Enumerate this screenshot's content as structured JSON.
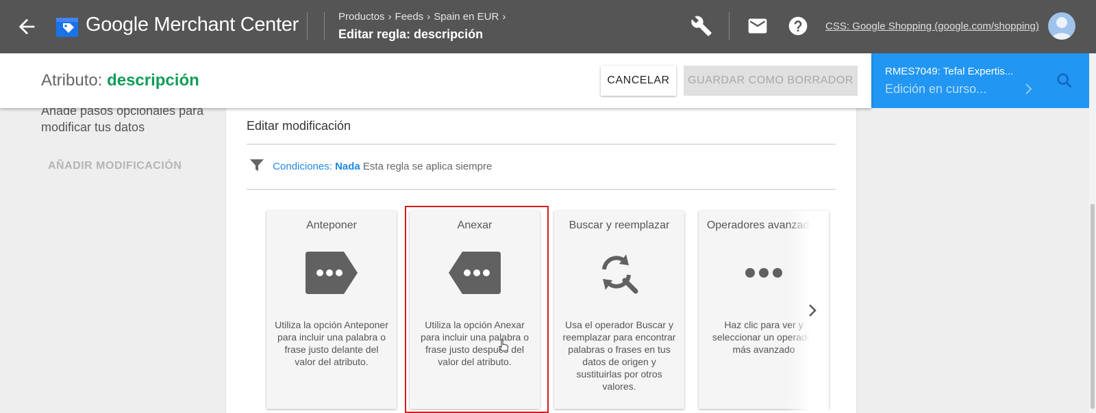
{
  "topbar": {
    "app_title": "Google Merchant Center",
    "breadcrumbs": [
      "Productos",
      "Feeds",
      "Spain en EUR"
    ],
    "page_heading": "Editar regla: descripción",
    "account_link": "CSS: Google Shopping (google.com/shopping)",
    "icons": [
      "back-arrow-icon",
      "merchant-center-logo-icon",
      "wrench-icon",
      "mail-icon",
      "help-icon",
      "avatar"
    ]
  },
  "header": {
    "attr_label": "Atributo:",
    "attr_value": "descripción",
    "cancel_label": "CANCELAR",
    "draft_label": "GUARDAR COMO BORRADOR"
  },
  "task": {
    "title": "RMES7049: Tefal Expertis...",
    "status": "Edición en curso..."
  },
  "left": {
    "description": "Añade pasos opcionales para modificar tus datos",
    "add_label": "AÑADIR MODIFICACIÓN"
  },
  "edit": {
    "section_title": "Editar modificación",
    "conditions_label": "Condiciones:",
    "conditions_value": "Nada",
    "conditions_text": "Esta regla se aplica siempre"
  },
  "operations": [
    {
      "title": "Anteponer",
      "icon": "prepend-tag-icon",
      "desc": "Utiliza la opción Anteponer para incluir una palabra o frase justo delante del valor del atributo."
    },
    {
      "title": "Anexar",
      "icon": "append-tag-icon",
      "desc": "Utiliza la opción Anexar para incluir una palabra o frase justo después del valor del atributo."
    },
    {
      "title": "Buscar y reemplazar",
      "icon": "search-replace-icon",
      "desc": "Usa el operador Buscar y reemplazar para encontrar palabras o frases en tus datos de origen y sustituirlas por otros valores."
    },
    {
      "title": "Operadores avanzados",
      "icon": "more-dots-icon",
      "desc": "Haz clic para ver y seleccionar un operador más avanzado"
    }
  ],
  "colors": {
    "topbar": "#555555",
    "accent_green": "#0f9d58",
    "link_blue": "#1e88e5",
    "task_blue": "#2196f3",
    "highlight_red": "#d11c1c"
  }
}
